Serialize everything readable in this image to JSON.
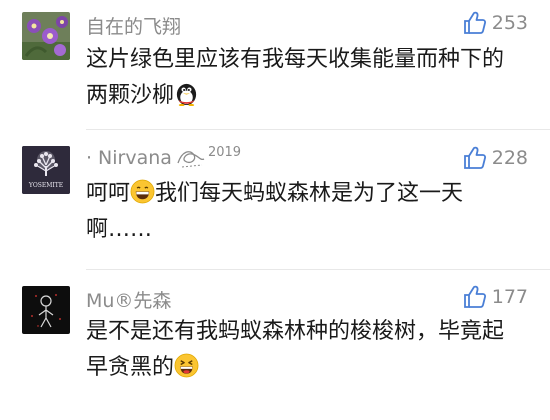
{
  "comments": [
    {
      "nickname": "自在的飞翔",
      "likes": "253",
      "text": "这片绿色里应该有我每天收集能量而种下的两颗沙柳",
      "emoji": "penguin-emoji",
      "avatar": "flower-avatar"
    },
    {
      "nickname": "Nirvana",
      "nickname_prefix": "·",
      "nickname_suffix": "2019",
      "likes": "228",
      "text_before_emoji": "呵呵",
      "text_after_emoji": "我们每天蚂蚁森林是为了这一天啊……",
      "emoji": "grinning-emoji",
      "avatar": "yosemite-tree-avatar",
      "avatar_label": "YOSEMITE"
    },
    {
      "nickname": "Mu®先森",
      "likes": "177",
      "text": "是不是还有我蚂蚁森林种的梭梭树，毕竟起早贪黑的",
      "emoji": "laughing-emoji",
      "avatar": "dark-figure-avatar"
    }
  ],
  "colors": {
    "meta_gray": "#8b8b8b",
    "text_dark": "#1a1a1a",
    "divider": "#e8e8e8",
    "like_icon_blue": "#4a7fd6"
  }
}
